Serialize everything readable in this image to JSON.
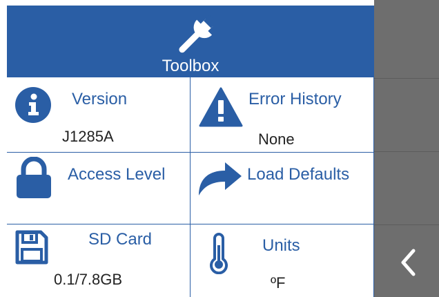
{
  "header": {
    "title": "Toolbox",
    "icon": "wrench-icon"
  },
  "tiles": {
    "version": {
      "label": "Version",
      "value": "J1285A",
      "icon": "info-icon"
    },
    "error_history": {
      "label": "Error History",
      "value": "None",
      "icon": "warning-icon"
    },
    "access_level": {
      "label": "Access Level",
      "icon": "lock-icon"
    },
    "load_defaults": {
      "label": "Load Defaults",
      "icon": "redo-arrow-icon"
    },
    "sd_card": {
      "label": "SD Card",
      "value": "0.1/7.8GB",
      "icon": "floppy-disk-icon"
    },
    "units": {
      "label": "Units",
      "value": "ºF",
      "icon": "thermometer-icon"
    }
  },
  "sidebar": {
    "back_icon": "chevron-left-icon"
  },
  "colors": {
    "accent": "#2a5ea5",
    "sidebar": "#6e6e6e",
    "text": "#222222",
    "background": "#ffffff"
  }
}
